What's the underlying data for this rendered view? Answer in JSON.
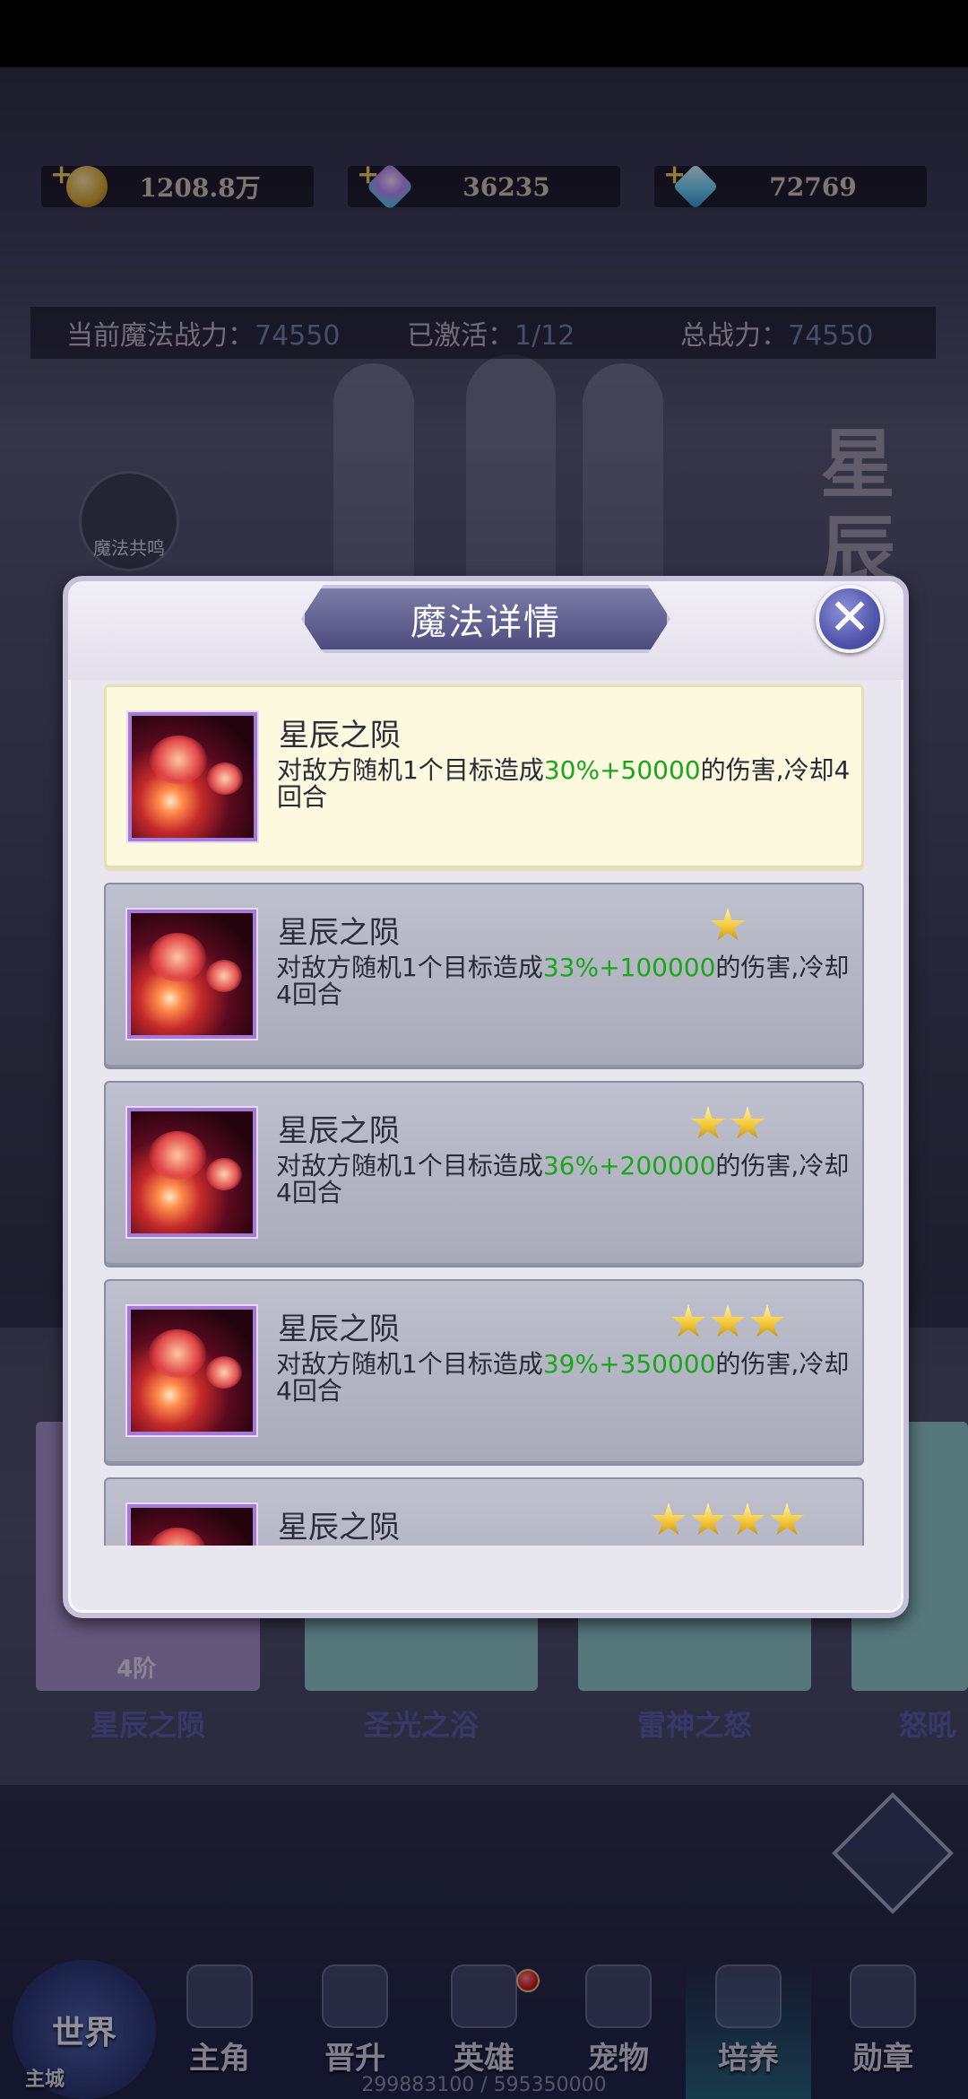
{
  "currencies": [
    {
      "icon": "gold-coin-icon",
      "value": "1208.8万"
    },
    {
      "icon": "rainbow-gem-icon",
      "value": "36235"
    },
    {
      "icon": "diamond-icon",
      "value": "72769"
    }
  ],
  "power_bar": {
    "current_label": "当前魔法战力：",
    "current_value": "74550",
    "activated_label": "已激活：",
    "activated_value": "1/12",
    "total_label": "总战力：",
    "total_value": "74550"
  },
  "side_badge_label": "魔法共鸣",
  "right_title": "星辰",
  "strip": {
    "tier": "4阶",
    "labels": [
      "星辰之陨",
      "圣光之浴",
      "雷神之怒",
      "怒吼"
    ]
  },
  "modal": {
    "title": "魔法详情",
    "close_symbol": "✕",
    "cards": [
      {
        "name": "星辰之陨",
        "stars": 0,
        "desc_prefix": "对敌方随机1个目标造成",
        "desc_highlight": "30%+50000",
        "desc_suffix": "的伤害,冷却4回合",
        "selected": true
      },
      {
        "name": "星辰之陨",
        "stars": 1,
        "desc_prefix": "对敌方随机1个目标造成",
        "desc_highlight": "33%+100000",
        "desc_suffix": "的伤害,冷却4回合",
        "selected": false
      },
      {
        "name": "星辰之陨",
        "stars": 2,
        "desc_prefix": "对敌方随机1个目标造成",
        "desc_highlight": "36%+200000",
        "desc_suffix": "的伤害,冷却4回合",
        "selected": false
      },
      {
        "name": "星辰之陨",
        "stars": 3,
        "desc_prefix": "对敌方随机1个目标造成",
        "desc_highlight": "39%+350000",
        "desc_suffix": "的伤害,冷却4回合",
        "selected": false
      },
      {
        "name": "星辰之陨",
        "stars": 4,
        "desc_prefix": "",
        "desc_highlight": "",
        "desc_suffix": "",
        "selected": false
      }
    ]
  },
  "bottom_nav": {
    "world": "世界",
    "main_city": "主城",
    "items": [
      "主角",
      "晋升",
      "英雄",
      "宠物",
      "培养",
      "勋章"
    ],
    "active_index": 4
  },
  "exp_text": "299883100 / 595350000",
  "colors": {
    "highlight_green": "#1aa61a",
    "accent_purple": "#4e52a8"
  }
}
